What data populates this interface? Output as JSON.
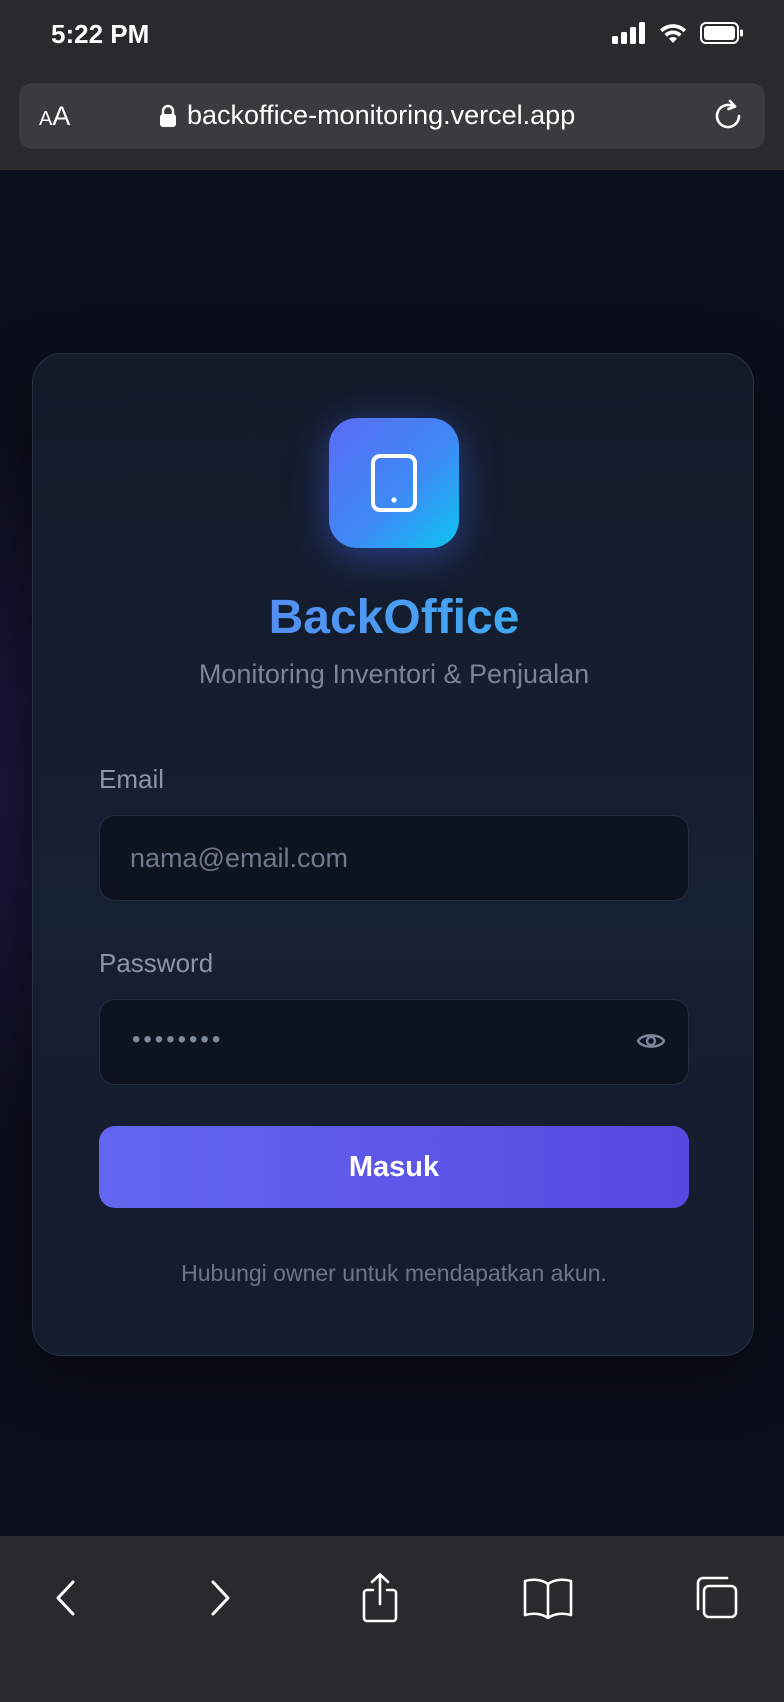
{
  "status_bar": {
    "time": "5:22 PM"
  },
  "browser": {
    "aa_small": "A",
    "aa_large": "A",
    "url": "backoffice-monitoring.vercel.app"
  },
  "login": {
    "brand_title": "BackOffice",
    "brand_subtitle": "Monitoring Inventori & Penjualan",
    "email_label": "Email",
    "email_placeholder": "nama@email.com",
    "password_label": "Password",
    "password_value": "••••••••",
    "submit_label": "Masuk",
    "helper_text": "Hubungi owner untuk mendapatkan akun."
  },
  "colors": {
    "accent": "#6366f1",
    "logo_gradient_start": "#5b6cf7",
    "logo_gradient_end": "#0ec4f0",
    "background": "#0b0f1c",
    "card": "#141c2d"
  },
  "icons": {
    "signal": "cellular-signal-icon",
    "wifi": "wifi-icon",
    "battery": "battery-icon",
    "lock": "lock-icon",
    "reload": "reload-icon",
    "logo": "tablet-icon",
    "eye": "eye-icon",
    "back": "chevron-left-icon",
    "forward": "chevron-right-icon",
    "share": "share-icon",
    "bookmarks": "book-icon",
    "tabs": "tabs-icon"
  }
}
